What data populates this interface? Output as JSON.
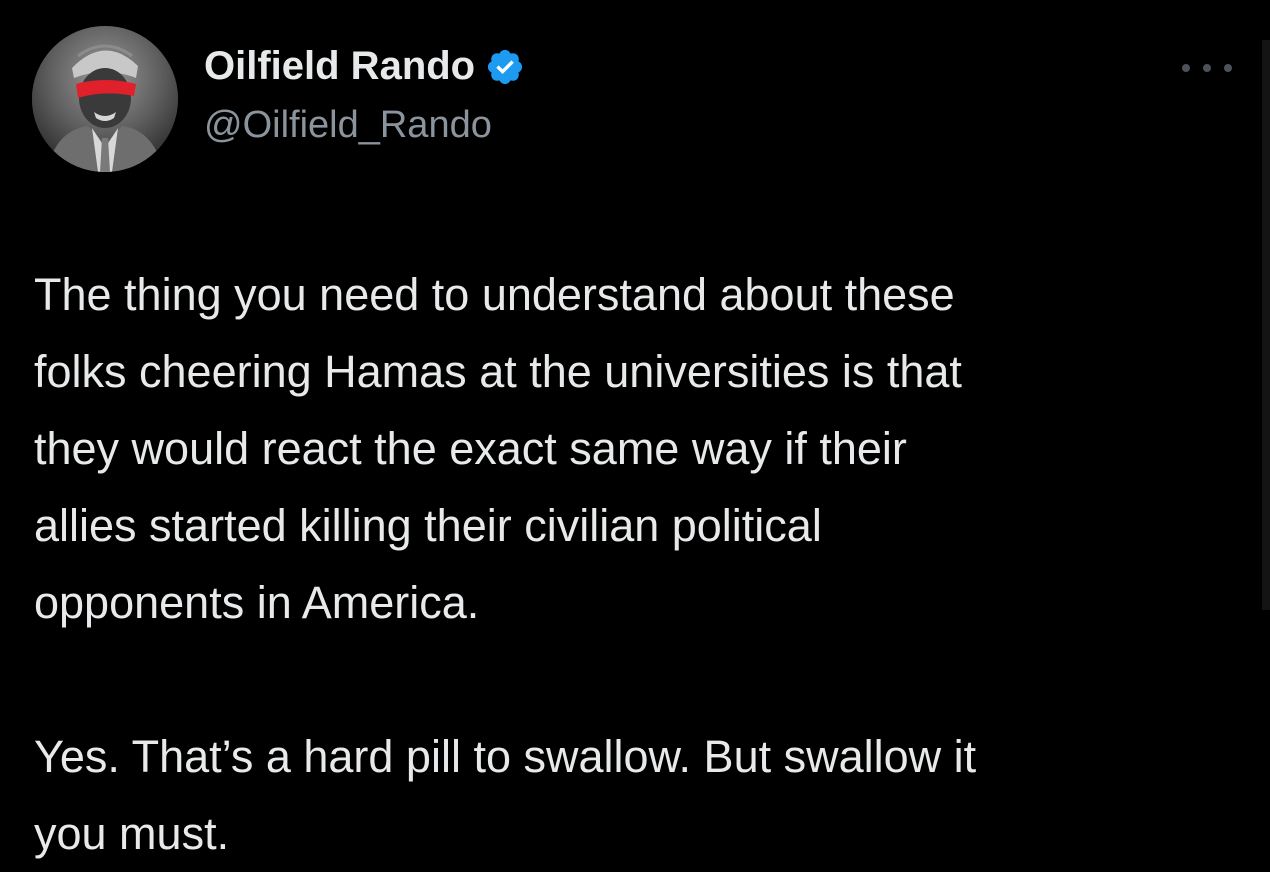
{
  "tweet": {
    "author": {
      "display_name": "Oilfield Rando",
      "handle": "@Oilfield_Rando",
      "verified_icon": "verified-badge-icon",
      "verified_color": "#1d9bf0"
    },
    "more_icon": "more-horizontal-icon",
    "body": {
      "paragraph_1": [
        "The thing you need to understand about these",
        "folks cheering Hamas at the universities is that",
        "they would react the exact same way if their",
        "allies started killing their civilian political",
        "opponents in America."
      ],
      "paragraph_2": [
        "Yes. That’s a hard pill to swallow. But swallow it",
        "you must."
      ]
    }
  },
  "colors": {
    "background": "#000000",
    "text_primary": "#e7e9ea",
    "text_secondary": "#8b949c",
    "avatar_redaction": "#e0202a"
  }
}
